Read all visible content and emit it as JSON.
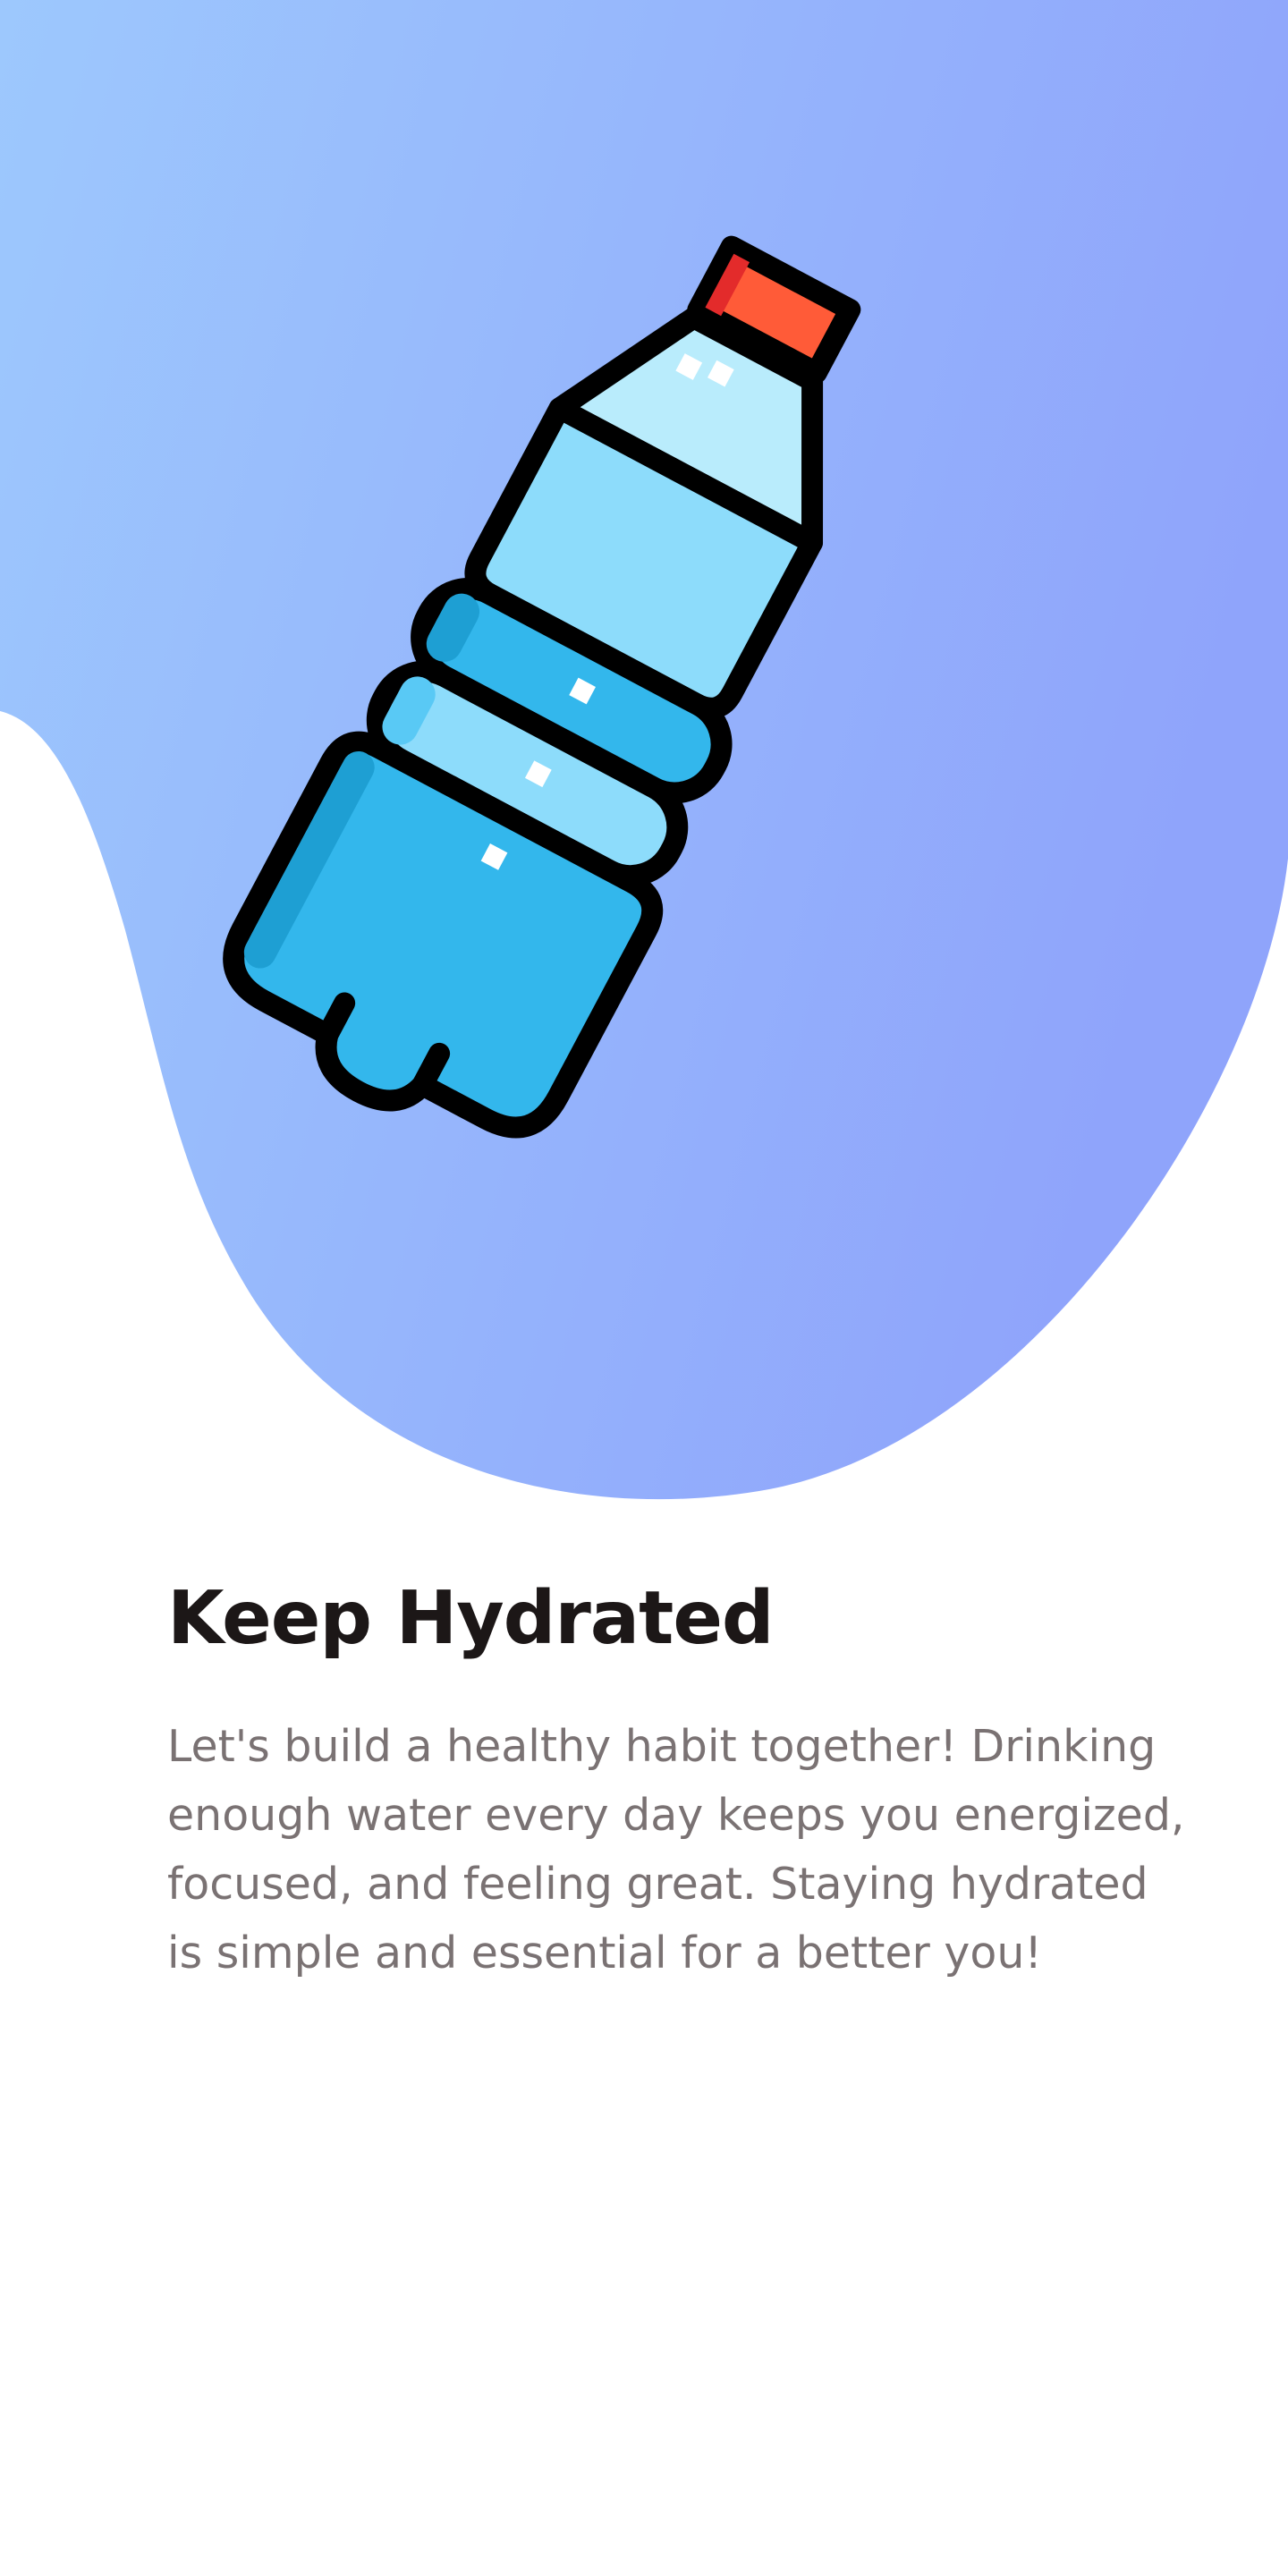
{
  "onboarding": {
    "illustration": {
      "icon": "water-bottle-icon",
      "blob_gradient": [
        "#9dc8fd",
        "#8fa6fb"
      ]
    },
    "title": "Keep Hydrated",
    "description": "Let's build a healthy habit together! Drinking enough water every day keeps you energized, focused, and feeling great. Staying hydrated is simple and essential for a better you!"
  }
}
